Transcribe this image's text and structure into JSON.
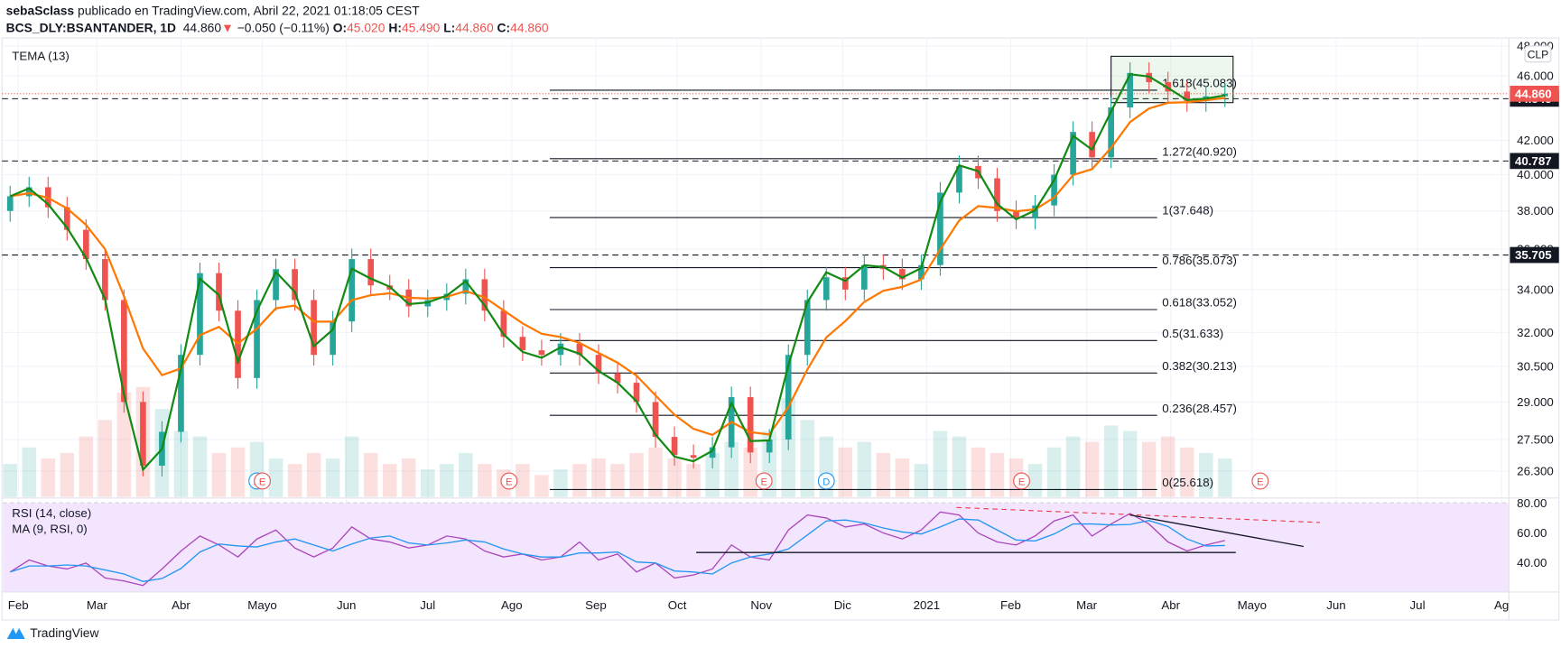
{
  "header": {
    "author": "sebaSclass",
    "published": "publicado en TradingView.com, Abril 22, 2021 01:18:05 CEST",
    "symbol": "BCS_DLY:BSANTANDER, 1D",
    "last": "44.860",
    "change": "−0.050 (−0.11%)",
    "o_label": "O:",
    "o": "45.020",
    "h_label": "H:",
    "h": "45.490",
    "l_label": "L:",
    "l": "44.860",
    "c_label": "C:",
    "c": "44.860"
  },
  "indicators": {
    "tema": "TEMA (13)",
    "rsi": "RSI (14, close)",
    "rsi_ma": "MA (9, RSI, 0)"
  },
  "currency": "CLP",
  "logo": "TradingView",
  "colors": {
    "up": "#26a69a",
    "down": "#ef5350",
    "tema": "#138a13",
    "ema": "#ff7700",
    "rsi": "#ab47bc",
    "rsi_ma": "#2196f3",
    "rsi_bg": "#f3e5fd"
  },
  "chart_data": {
    "type": "candlestick",
    "title": "BCS_DLY:BSANTANDER, 1D",
    "scale": "log",
    "ylim": [
      25.5,
      48.5
    ],
    "price_ticks": [
      48,
      46,
      42,
      40,
      38,
      36,
      34,
      32,
      30.5,
      29,
      27.5,
      26.3
    ],
    "x_labels": [
      {
        "label": "Feb",
        "date": "2020-02-01"
      },
      {
        "label": "Mar",
        "date": "2020-03-01"
      },
      {
        "label": "Abr",
        "date": "2020-04-01"
      },
      {
        "label": "Mayo",
        "date": "2020-05-01"
      },
      {
        "label": "Jun",
        "date": "2020-06-01"
      },
      {
        "label": "Jul",
        "date": "2020-07-01"
      },
      {
        "label": "Ago",
        "date": "2020-08-01"
      },
      {
        "label": "Sep",
        "date": "2020-09-01"
      },
      {
        "label": "Oct",
        "date": "2020-10-01"
      },
      {
        "label": "Nov",
        "date": "2020-11-01"
      },
      {
        "label": "Dic",
        "date": "2020-12-01"
      },
      {
        "label": "2021",
        "date": "2021-01-01"
      },
      {
        "label": "Feb",
        "date": "2021-02-01"
      },
      {
        "label": "Mar",
        "date": "2021-03-01"
      },
      {
        "label": "Abr",
        "date": "2021-04-01"
      },
      {
        "label": "Mayo",
        "date": "2021-05-01"
      },
      {
        "label": "Jun",
        "date": "2021-06-01"
      },
      {
        "label": "Jul",
        "date": "2021-07-01"
      },
      {
        "label": "Ag",
        "date": "2021-08-01"
      }
    ],
    "start_week": "2020-01-27",
    "closes": [
      38.8,
      39.3,
      38.2,
      37.0,
      35.5,
      33.5,
      29.0,
      26.5,
      27.8,
      31.0,
      34.8,
      33.0,
      30.0,
      33.5,
      35.0,
      33.5,
      31.0,
      32.5,
      35.5,
      34.2,
      34.0,
      33.2,
      33.5,
      33.8,
      34.5,
      33.0,
      31.8,
      31.2,
      31.0,
      31.5,
      31.0,
      30.2,
      29.8,
      29.0,
      27.6,
      26.9,
      26.8,
      27.2,
      29.2,
      27.0,
      27.5,
      31.0,
      33.5,
      34.6,
      34.0,
      35.2,
      35.0,
      34.5,
      35.2,
      39.0,
      40.5,
      39.8,
      38.0,
      37.6,
      38.3,
      40.0,
      42.5,
      41.0,
      44.0,
      46.2,
      45.6,
      45.0,
      44.4,
      44.7,
      44.86
    ],
    "first_open": 38.0,
    "volume": [
      30,
      45,
      35,
      40,
      55,
      70,
      95,
      100,
      80,
      60,
      55,
      40,
      45,
      50,
      35,
      30,
      40,
      35,
      55,
      40,
      30,
      35,
      25,
      30,
      40,
      30,
      25,
      30,
      20,
      25,
      30,
      35,
      30,
      40,
      45,
      35,
      30,
      40,
      50,
      45,
      60,
      90,
      70,
      55,
      45,
      50,
      40,
      35,
      30,
      60,
      55,
      45,
      40,
      35,
      30,
      45,
      55,
      50,
      65,
      60,
      50,
      55,
      45,
      40,
      35
    ],
    "rsi": [
      34,
      42,
      38,
      36,
      40,
      30,
      28,
      25,
      36,
      48,
      58,
      52,
      44,
      56,
      62,
      50,
      44,
      50,
      64,
      56,
      54,
      50,
      52,
      58,
      56,
      48,
      44,
      46,
      42,
      44,
      54,
      42,
      46,
      34,
      40,
      30,
      32,
      36,
      52,
      44,
      42,
      62,
      72,
      70,
      64,
      66,
      60,
      56,
      62,
      74,
      72,
      60,
      54,
      52,
      58,
      68,
      72,
      58,
      66,
      73,
      66,
      54,
      48,
      52,
      55
    ],
    "rsi_ticks": [
      80,
      60,
      40
    ],
    "current_price": {
      "value": 44.86,
      "label": "44.860"
    },
    "horizontal_levels": [
      {
        "value": 44.545,
        "label": "44.545"
      },
      {
        "value": 40.787,
        "label": "40.787"
      },
      {
        "value": 35.705,
        "label": "35.705"
      }
    ],
    "fibonacci": {
      "from": "2020-08-15",
      "to": "2021-03-27",
      "levels": [
        {
          "label": "1.618(45.083)",
          "value": 45.083
        },
        {
          "label": "1.272(40.920)",
          "value": 40.92
        },
        {
          "label": "1(37.648)",
          "value": 37.648
        },
        {
          "label": "0.786(35.073)",
          "value": 35.073
        },
        {
          "label": "0.618(33.052)",
          "value": 33.052
        },
        {
          "label": "0.5(31.633)",
          "value": 31.633
        },
        {
          "label": "0.382(30.213)",
          "value": 30.213
        },
        {
          "label": "0.236(28.457)",
          "value": 28.457
        },
        {
          "label": "0(25.618)",
          "value": 25.618
        }
      ]
    },
    "rectangle": {
      "from": "2021-03-10",
      "to": "2021-04-24",
      "top": 47.3,
      "bottom": 44.3
    },
    "events": [
      {
        "type": "dividend",
        "label": "D",
        "date": "2020-04-29"
      },
      {
        "type": "earnings",
        "label": "E",
        "date": "2020-05-01"
      },
      {
        "type": "earnings",
        "label": "E",
        "date": "2020-07-31"
      },
      {
        "type": "earnings",
        "label": "E",
        "date": "2020-11-02"
      },
      {
        "type": "dividend",
        "label": "D",
        "date": "2020-11-25"
      },
      {
        "type": "earnings",
        "label": "E",
        "date": "2021-02-05"
      },
      {
        "type": "earnings",
        "label": "E",
        "date": "2021-05-04"
      }
    ],
    "rsi_drawings": [
      {
        "kind": "dashed-red",
        "from": [
          "2021-01-12",
          77
        ],
        "to": [
          "2021-05-26",
          67
        ]
      },
      {
        "kind": "solid-black",
        "from": [
          "2021-03-17",
          72
        ],
        "to": [
          "2021-05-20",
          51
        ]
      },
      {
        "kind": "solid-black",
        "from": [
          "2020-10-08",
          47
        ],
        "to": [
          "2021-04-25",
          47
        ]
      }
    ]
  }
}
